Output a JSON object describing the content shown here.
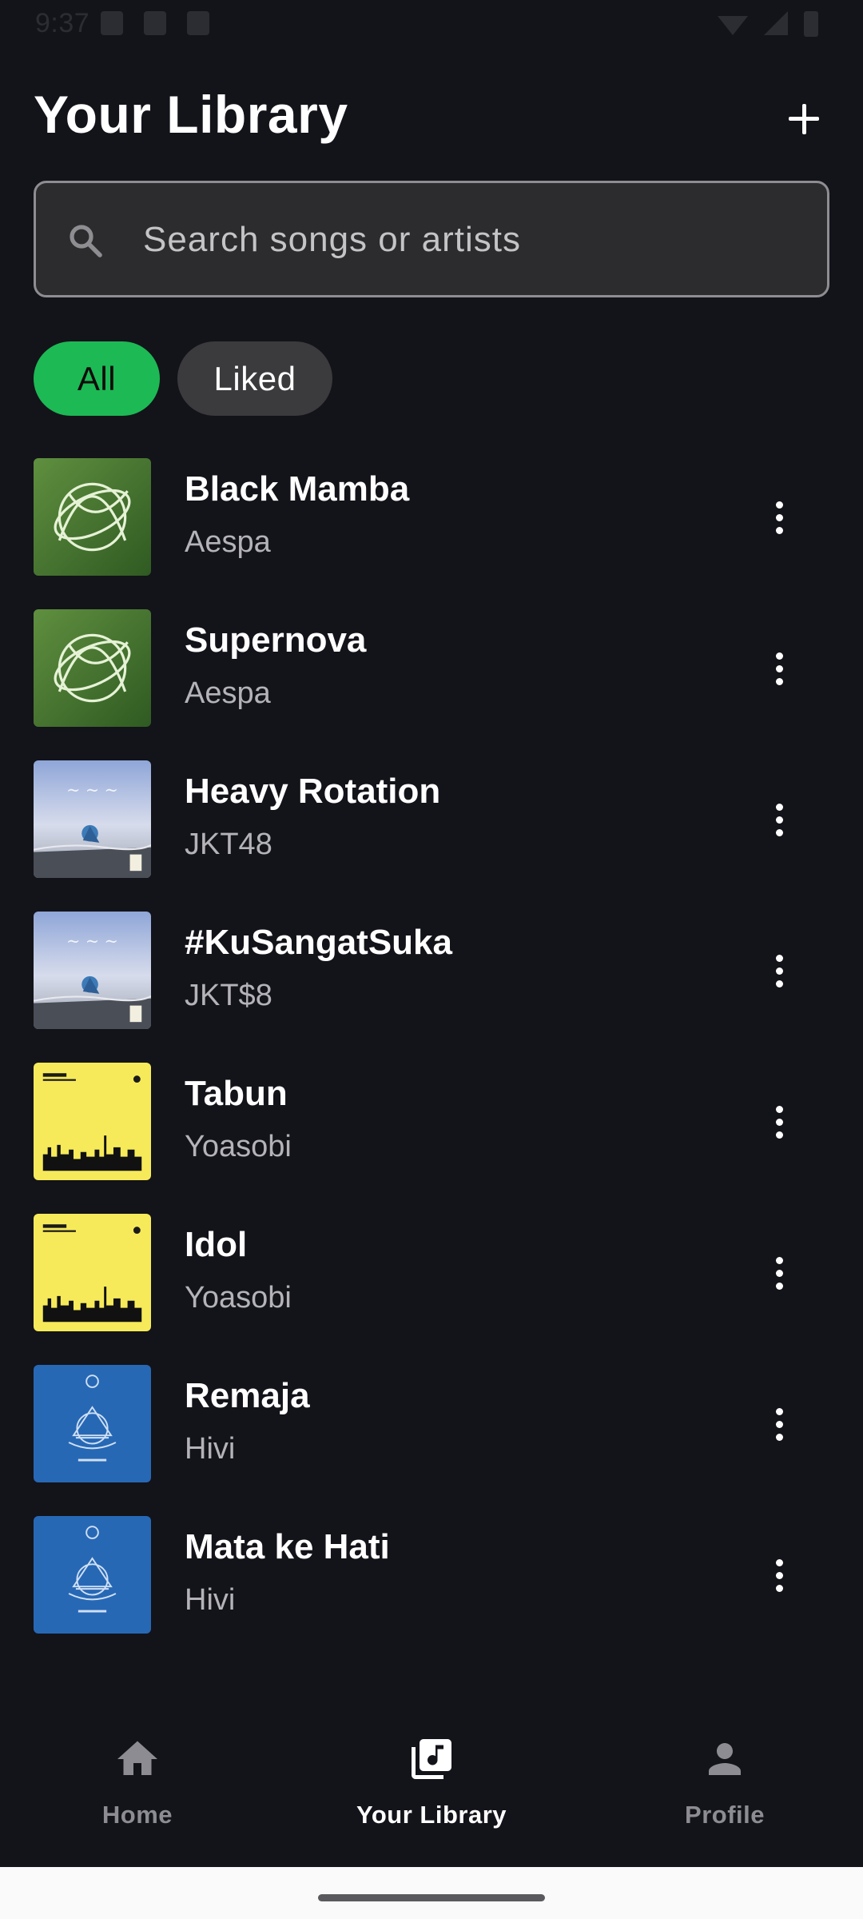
{
  "status_bar": {
    "time": "9:37"
  },
  "header": {
    "title": "Your Library",
    "add_icon": "plus-icon"
  },
  "search": {
    "placeholder": "Search songs or artists",
    "value": "",
    "icon": "search-icon"
  },
  "filters": [
    {
      "label": "All",
      "selected": true,
      "color": "#1db954"
    },
    {
      "label": "Liked",
      "selected": false,
      "color": "#3b3b3d"
    }
  ],
  "songs": [
    {
      "title": "Black Mamba",
      "artist": "Aespa",
      "art": "aespa"
    },
    {
      "title": "Supernova",
      "artist": "Aespa",
      "art": "aespa"
    },
    {
      "title": "Heavy Rotation",
      "artist": "JKT48",
      "art": "jkt48"
    },
    {
      "title": "#KuSangatSuka",
      "artist": "JKT$8",
      "art": "jkt48"
    },
    {
      "title": "Tabun",
      "artist": "Yoasobi",
      "art": "yoasobi"
    },
    {
      "title": "Idol",
      "artist": "Yoasobi",
      "art": "yoasobi"
    },
    {
      "title": "Remaja",
      "artist": "Hivi",
      "art": "hivi"
    },
    {
      "title": "Mata ke Hati",
      "artist": "Hivi",
      "art": "hivi"
    }
  ],
  "bottom_nav": {
    "items": [
      {
        "label": "Home",
        "icon": "home-icon",
        "active": false
      },
      {
        "label": "Your Library",
        "icon": "library-icon",
        "active": true
      },
      {
        "label": "Profile",
        "icon": "profile-icon",
        "active": false
      }
    ]
  },
  "colors": {
    "background": "#13131a",
    "accent": "#1db954",
    "text_secondary": "#b3b3b8",
    "nav_inactive": "#8c8c92"
  }
}
